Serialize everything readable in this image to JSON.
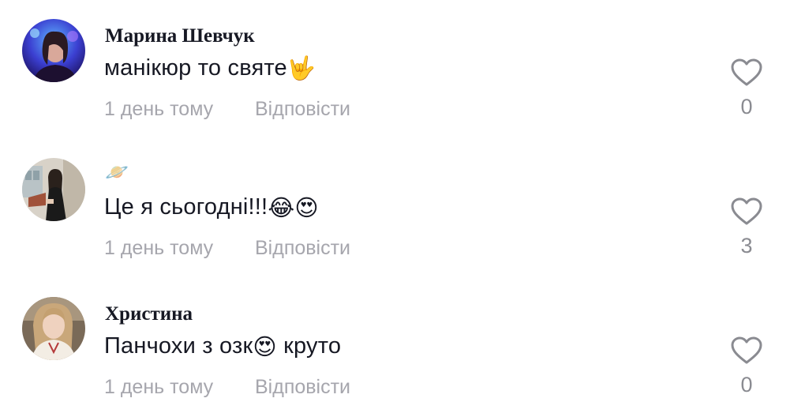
{
  "comments": [
    {
      "username": "Марина Шевчук",
      "text": "манікюр то святе",
      "emoji": "🤟",
      "time": "1 день тому",
      "reply": "Відповісти",
      "likes": "0"
    },
    {
      "username": "🪐",
      "text": "Це я сьогодні!!!",
      "emoji": "😂😍",
      "time": "1 день тому",
      "reply": "Відповісти",
      "likes": "3"
    },
    {
      "username": "Христина",
      "text": "Панчохи з озк",
      "text_after": " круто",
      "emoji": "😍",
      "time": "1 день тому",
      "reply": "Відповісти",
      "likes": "0"
    }
  ],
  "colors": {
    "text": "#161823",
    "muted": "#a6a6ad",
    "heart_outline": "#8a8b91"
  }
}
